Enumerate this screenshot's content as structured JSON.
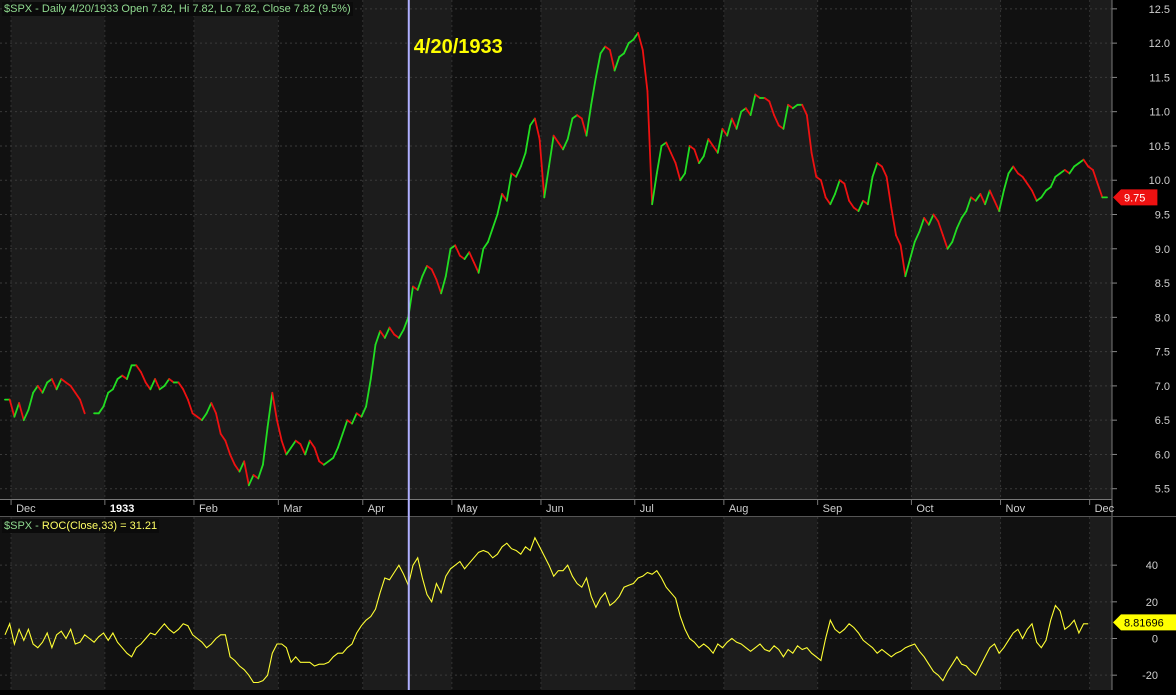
{
  "price_header": {
    "symbol": "$SPX",
    "text": "$SPX - Daily 4/20/1933 Open 7.82, Hi 7.82, Lo 7.82, Close 7.82 (9.5%)"
  },
  "roc_header": {
    "prefix": "$SPX - ",
    "indicator": "ROC(Close,33) = 31.21"
  },
  "marker_date_label": "4/20/1933",
  "colors": {
    "up": "#22dd22",
    "down": "#ee1111",
    "roc_line": "#ffff33",
    "marker": "#b0b0ff",
    "background_dark": "#111111",
    "background_light": "#1c1c1c",
    "label_yellow": "#ffff00",
    "last_price_badge": "#ee1111",
    "roc_badge": "#ffff00"
  },
  "chart_data": [
    {
      "type": "line",
      "name": "price",
      "x_labels": [
        "Dec",
        "1933",
        "Feb",
        "Mar",
        "Apr",
        "May",
        "Jun",
        "Jul",
        "Aug",
        "Sep",
        "Oct",
        "Nov",
        "Dec"
      ],
      "x_label_index": [
        3,
        23,
        42,
        60,
        78,
        97,
        116,
        136,
        155,
        175,
        195,
        214,
        233
      ],
      "y_ticks": [
        5.5,
        6.0,
        6.5,
        7.0,
        7.5,
        8.0,
        8.5,
        9.0,
        9.5,
        10.0,
        10.5,
        11.0,
        11.5,
        12.0,
        12.5
      ],
      "ylim": [
        5.35,
        12.6
      ],
      "last_value": "9.75",
      "marker_index": 86,
      "values": [
        6.8,
        6.8,
        6.55,
        6.75,
        6.5,
        6.65,
        6.9,
        7.0,
        6.9,
        7.05,
        7.1,
        6.95,
        7.1,
        7.05,
        7.0,
        6.9,
        6.8,
        6.6,
        null,
        6.6,
        6.6,
        6.7,
        6.9,
        6.95,
        7.1,
        7.15,
        7.1,
        7.3,
        7.3,
        7.2,
        7.05,
        6.95,
        7.1,
        6.95,
        7.0,
        7.1,
        7.05,
        7.05,
        6.95,
        6.8,
        6.6,
        6.55,
        6.5,
        6.6,
        6.75,
        6.6,
        6.3,
        6.2,
        6.0,
        5.85,
        5.75,
        5.9,
        5.55,
        5.7,
        5.65,
        5.85,
        6.4,
        6.9,
        6.5,
        6.2,
        6.0,
        6.1,
        6.2,
        6.15,
        6.0,
        6.2,
        6.1,
        5.9,
        5.85,
        5.9,
        5.95,
        6.1,
        6.3,
        6.5,
        6.45,
        6.6,
        6.55,
        6.7,
        7.1,
        7.6,
        7.8,
        7.7,
        7.85,
        7.75,
        7.7,
        7.82,
        8.0,
        8.45,
        8.4,
        8.6,
        8.75,
        8.7,
        8.55,
        8.35,
        8.6,
        9.0,
        9.05,
        8.9,
        8.85,
        8.95,
        8.8,
        8.65,
        9.0,
        9.1,
        9.3,
        9.5,
        9.8,
        9.7,
        10.1,
        10.05,
        10.2,
        10.4,
        10.8,
        10.9,
        10.6,
        9.75,
        10.2,
        10.65,
        10.55,
        10.45,
        10.6,
        10.9,
        10.95,
        10.9,
        10.65,
        11.1,
        11.5,
        11.85,
        11.95,
        11.9,
        11.6,
        11.8,
        11.85,
        12.0,
        12.05,
        12.15,
        11.9,
        11.3,
        9.65,
        10.1,
        10.5,
        10.55,
        10.4,
        10.25,
        10.0,
        10.1,
        10.5,
        10.45,
        10.25,
        10.35,
        10.6,
        10.5,
        10.4,
        10.75,
        10.65,
        10.9,
        10.75,
        11.0,
        11.05,
        10.95,
        11.25,
        11.2,
        11.2,
        11.15,
        10.95,
        10.8,
        10.75,
        11.1,
        11.05,
        11.1,
        11.1,
        10.95,
        10.4,
        10.05,
        10.0,
        9.75,
        9.65,
        9.8,
        10.0,
        9.95,
        9.7,
        9.6,
        9.55,
        9.7,
        9.65,
        10.05,
        10.25,
        10.2,
        10.05,
        9.6,
        9.2,
        9.05,
        8.6,
        8.85,
        9.1,
        9.25,
        9.45,
        9.35,
        9.5,
        9.4,
        9.2,
        9.0,
        9.1,
        9.3,
        9.45,
        9.55,
        9.75,
        9.7,
        9.8,
        9.65,
        9.85,
        9.7,
        9.55,
        9.85,
        10.1,
        10.2,
        10.1,
        10.05,
        9.95,
        9.85,
        9.7,
        9.75,
        9.85,
        9.9,
        10.05,
        10.1,
        10.15,
        10.1,
        10.2,
        10.25,
        10.3,
        10.2,
        10.15,
        9.95,
        9.75,
        9.75
      ]
    },
    {
      "type": "line",
      "name": "ROC(Close,33)",
      "x_labels": [],
      "y_ticks": [
        -20,
        0,
        20,
        40
      ],
      "ylim": [
        -27,
        57
      ],
      "last_value": "8.81696",
      "marker_index": 86,
      "values": [
        2,
        8,
        -3,
        5,
        -1,
        5,
        -3,
        -5,
        -2,
        3,
        -5,
        2,
        4,
        0,
        5,
        -3,
        -2,
        2,
        0,
        -2,
        1,
        3,
        -1,
        3,
        -2,
        -5,
        -8,
        -10,
        -5,
        -3,
        0,
        3,
        2,
        5,
        8,
        5,
        3,
        5,
        8,
        7,
        2,
        0,
        -2,
        -5,
        -3,
        0,
        2,
        2,
        -10,
        -12,
        -15,
        -17,
        -20,
        -24,
        -24,
        -23,
        -20,
        -8,
        -3,
        -3,
        -5,
        -13,
        -10,
        -13,
        -13,
        -13,
        -15,
        -14,
        -14,
        -13,
        -10,
        -8,
        -8,
        -5,
        -3,
        3,
        7,
        10,
        12,
        16,
        25,
        33,
        32,
        36,
        40,
        35,
        29,
        40,
        44,
        33,
        24,
        20,
        30,
        25,
        34,
        38,
        40,
        42,
        38,
        41,
        44,
        47,
        48,
        47,
        44,
        46,
        50,
        52,
        49,
        48,
        46,
        50,
        48,
        55,
        50,
        45,
        40,
        34,
        37,
        37,
        40,
        34,
        30,
        28,
        33,
        23,
        17,
        22,
        25,
        18,
        20,
        23,
        28,
        29,
        30,
        33,
        34,
        36,
        35,
        37,
        33,
        28,
        25,
        22,
        12,
        5,
        0,
        -2,
        -5,
        -3,
        -5,
        -8,
        -3,
        -5,
        -2,
        0,
        -2,
        -3,
        -5,
        -7,
        -5,
        -3,
        -6,
        -7,
        -4,
        -6,
        -10,
        -6,
        -8,
        -4,
        -6,
        -5,
        -8,
        -10,
        -12,
        0,
        10,
        5,
        3,
        5,
        8,
        6,
        3,
        -1,
        -3,
        -5,
        -8,
        -6,
        -8,
        -10,
        -8,
        -7,
        -5,
        -4,
        -3,
        -7,
        -10,
        -14,
        -18,
        -20,
        -23,
        -18,
        -14,
        -10,
        -14,
        -15,
        -18,
        -20,
        -15,
        -10,
        -5,
        -3,
        -8,
        -5,
        -1,
        3,
        5,
        0,
        5,
        8,
        -2,
        -5,
        -1,
        10,
        18,
        15,
        5,
        7,
        10,
        3,
        8,
        8
      ]
    }
  ]
}
